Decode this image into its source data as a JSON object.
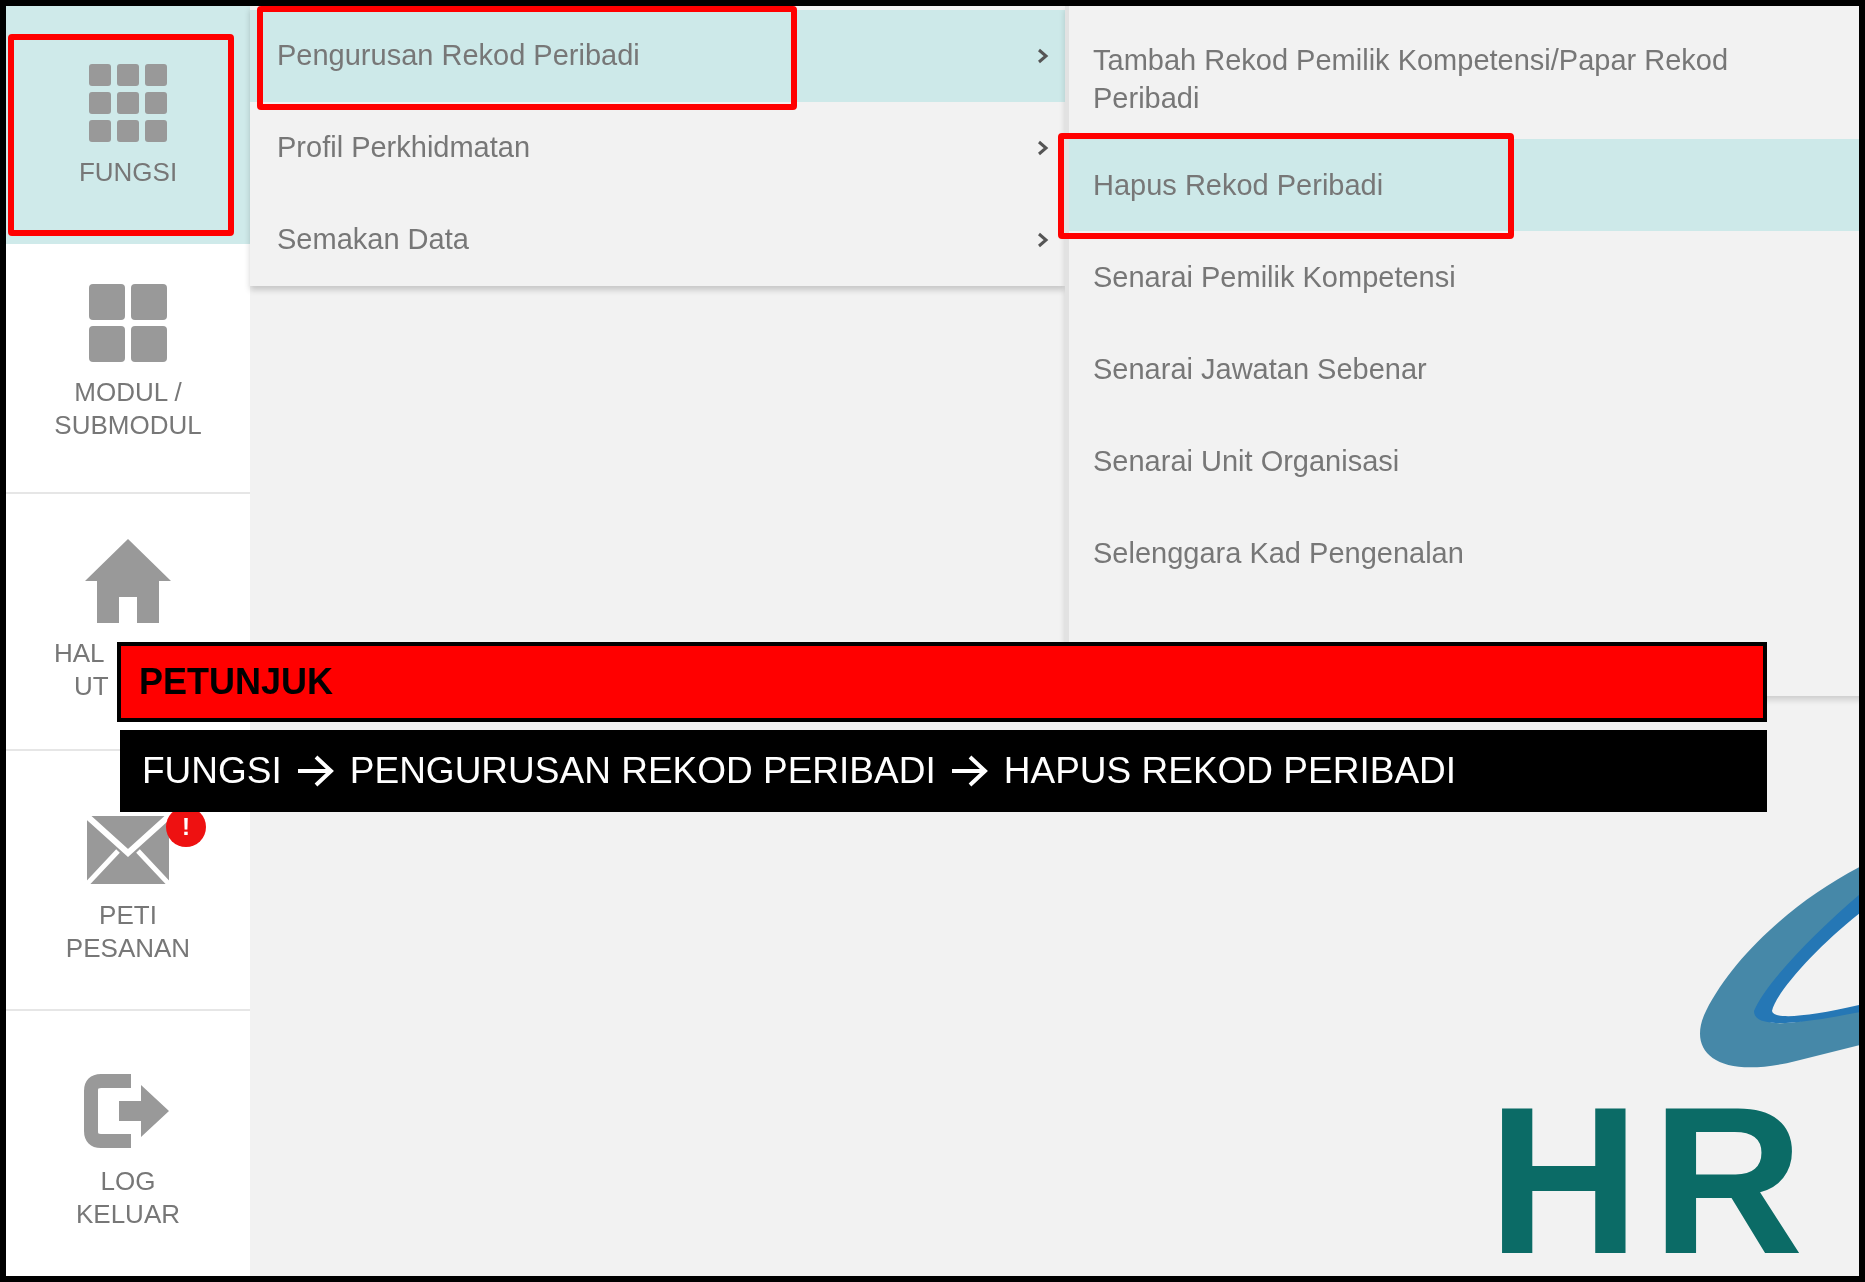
{
  "sidebar": {
    "items": [
      {
        "lines": [
          "FUNGSI"
        ],
        "selected": true,
        "annotated": true
      },
      {
        "lines": [
          "MODUL /",
          "SUBMODUL"
        ],
        "selected": false,
        "annotated": false
      },
      {
        "lines": [
          "HAL",
          "UT"
        ],
        "selected": false,
        "annotated": false
      },
      {
        "lines": [
          "PETI",
          "PESANAN"
        ],
        "selected": false,
        "annotated": false,
        "badge": "!"
      },
      {
        "lines": [
          "LOG",
          "KELUAR"
        ],
        "selected": false,
        "annotated": false
      }
    ]
  },
  "menu": {
    "items": [
      {
        "label": "Pengurusan Rekod Peribadi",
        "has_submenu": true,
        "selected": true,
        "annotated": true
      },
      {
        "label": "Profil Perkhidmatan",
        "has_submenu": true,
        "selected": false,
        "annotated": false
      },
      {
        "label": "Semakan Data",
        "has_submenu": true,
        "selected": false,
        "annotated": false
      }
    ]
  },
  "submenu": {
    "items": [
      {
        "label": "Tambah Rekod Pemilik Kompetensi/Papar Rekod Peribadi",
        "selected": false,
        "annotated": false
      },
      {
        "label": "Hapus Rekod Peribadi",
        "selected": true,
        "annotated": true
      },
      {
        "label": "Senarai Pemilik Kompetensi",
        "selected": false,
        "annotated": false
      },
      {
        "label": "Senarai Jawatan Sebenar",
        "selected": false,
        "annotated": false
      },
      {
        "label": "Senarai Unit Organisasi",
        "selected": false,
        "annotated": false
      },
      {
        "label": "Selenggara Kad Pengenalan",
        "selected": false,
        "annotated": false
      }
    ]
  },
  "hint": {
    "title": "PETUNJUK",
    "path": [
      "FUNGSI",
      "PENGURUSAN REKOD PERIBADI",
      "HAPUS REKOD PERIBADI"
    ]
  },
  "logo": {
    "text": "HR"
  }
}
